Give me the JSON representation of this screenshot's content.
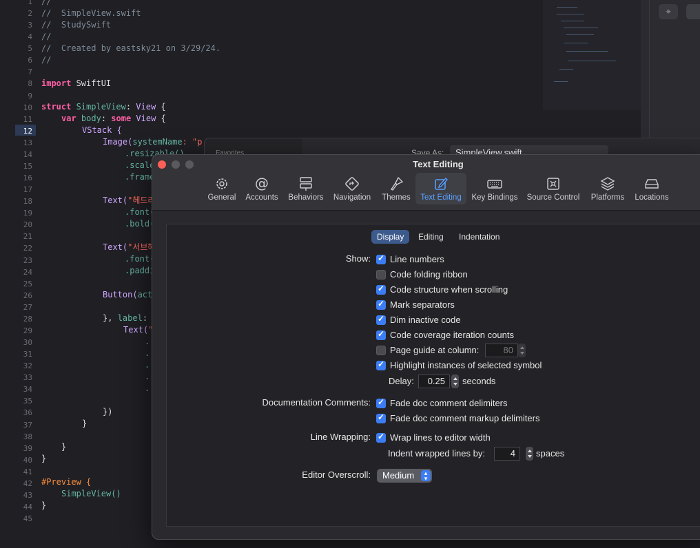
{
  "editor": {
    "line_numbers": [
      "1",
      "2",
      "3",
      "4",
      "5",
      "6",
      "7",
      "8",
      "9",
      "10",
      "11",
      "12",
      "13",
      "14",
      "15",
      "16",
      "17",
      "18",
      "19",
      "20",
      "21",
      "22",
      "23",
      "24",
      "25",
      "26",
      "27",
      "28",
      "29",
      "30",
      "31",
      "32",
      "33",
      "34",
      "35",
      "36",
      "37",
      "38",
      "39",
      "40",
      "41",
      "42",
      "43",
      "44",
      "45"
    ],
    "active_line": "12",
    "lines": {
      "l1": "//",
      "l2": "//  SimpleView.swift",
      "l3": "//  StudySwift",
      "l4": "//",
      "l5": "//  Created by eastsky21 on 3/29/24.",
      "l6": "//",
      "l8_kw": "import",
      "l8_rest": " SwiftUI",
      "l10_kw": "struct",
      "l10_name": " SimpleView",
      "l10_rest": ": ",
      "l10_type": "View",
      "l10_end": " {",
      "l11_kw": "var",
      "l11_body": " body",
      "l11_mid": ": ",
      "l11_some": "some",
      "l11_type": " View",
      "l11_end": " {",
      "l12": "VStack {",
      "l13_a": "Image(",
      "l13_b": "systemName",
      "l13_c": ": \"p",
      "l14": ".resizable()",
      "l15": ".scale",
      "l16": ".frame",
      "l18_a": "Text(",
      "l18_b": "\"헤드라",
      "l19": ".font(",
      "l20": ".bold(",
      "l22_a": "Text(",
      "l22_b": "\"서브헤",
      "l23": ".font(",
      "l24": ".paddi",
      "l26_a": "Button(",
      "l26_b": "act",
      "l28_a": "}, ",
      "l28_b": "label",
      "l28_c": ":",
      "l29_a": "Text(",
      "l29_b": "\"",
      "l30": ".",
      "l31": ".",
      "l32": ".",
      "l33": ".",
      "l34": ".",
      "l36": "})",
      "l37": "}",
      "l39": "}",
      "l40": "}",
      "l42": "#Preview {",
      "l43": "SimpleView()",
      "l44": "}"
    }
  },
  "sheet": {
    "favorites": "Favorites",
    "save_as_label": "Save As:",
    "save_as_value": "SimpleView.swift"
  },
  "window": {
    "title": "Text Editing",
    "toolbar": [
      {
        "label": "General",
        "icon": "gear-icon"
      },
      {
        "label": "Accounts",
        "icon": "at-icon"
      },
      {
        "label": "Behaviors",
        "icon": "behaviors-icon"
      },
      {
        "label": "Navigation",
        "icon": "navigation-icon"
      },
      {
        "label": "Themes",
        "icon": "brush-icon"
      },
      {
        "label": "Text Editing",
        "icon": "pencil-square-icon"
      },
      {
        "label": "Key Bindings",
        "icon": "keyboard-icon"
      },
      {
        "label": "Source Control",
        "icon": "source-control-icon"
      },
      {
        "label": "Platforms",
        "icon": "layers-icon"
      },
      {
        "label": "Locations",
        "icon": "drive-icon"
      }
    ],
    "selected_tab": "Text Editing",
    "segments": [
      "Display",
      "Editing",
      "Indentation"
    ],
    "selected_segment": "Display"
  },
  "display": {
    "show_label": "Show:",
    "options": [
      {
        "label": "Line numbers",
        "checked": true
      },
      {
        "label": "Code folding ribbon",
        "checked": false
      },
      {
        "label": "Code structure when scrolling",
        "checked": true
      },
      {
        "label": "Mark separators",
        "checked": true
      },
      {
        "label": "Dim inactive code",
        "checked": true
      },
      {
        "label": "Code coverage iteration counts",
        "checked": true
      },
      {
        "label": "Page guide at column:",
        "checked": false
      },
      {
        "label": "Highlight instances of selected symbol",
        "checked": true
      }
    ],
    "page_guide_value": "80",
    "delay_label": "Delay:",
    "delay_value": "0.25",
    "delay_unit": "seconds",
    "doc_comments_label": "Documentation Comments:",
    "doc_options": [
      {
        "label": "Fade doc comment delimiters",
        "checked": true
      },
      {
        "label": "Fade doc comment markup delimiters",
        "checked": true
      }
    ],
    "line_wrapping_label": "Line Wrapping:",
    "wrap_option": {
      "label": "Wrap lines to editor width",
      "checked": true
    },
    "indent_label": "Indent wrapped lines by:",
    "indent_value": "4",
    "indent_unit": "spaces",
    "overscroll_label": "Editor Overscroll:",
    "overscroll_value": "Medium"
  },
  "colors": {
    "accent": "#3c7df3",
    "close": "#fe5f57",
    "selected_segment": "#3d5a8c"
  }
}
